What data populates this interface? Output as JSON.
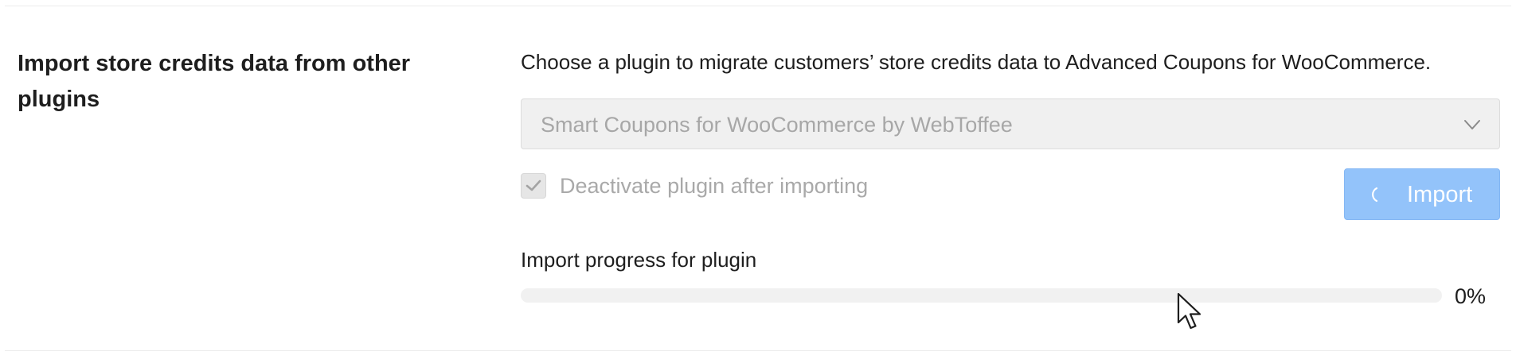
{
  "section": {
    "label": "Import store credits data from other plugins"
  },
  "description": "Choose a plugin to migrate customers’ store credits data to Advanced Coupons for WooCommerce.",
  "plugin_select": {
    "value": "Smart Coupons for WooCommerce by WebToffee",
    "icon": "chevron-down-icon"
  },
  "deactivate_checkbox": {
    "label": "Deactivate plugin after importing",
    "checked": true,
    "icon": "checkmark-icon"
  },
  "import_button": {
    "label": "Import",
    "icon": "spinner-icon",
    "color": "#93c3fa"
  },
  "progress": {
    "label": "Import progress for plugin",
    "value": 0,
    "percent_text": "0%"
  },
  "cursor": {
    "icon": "mouse-pointer-icon"
  }
}
